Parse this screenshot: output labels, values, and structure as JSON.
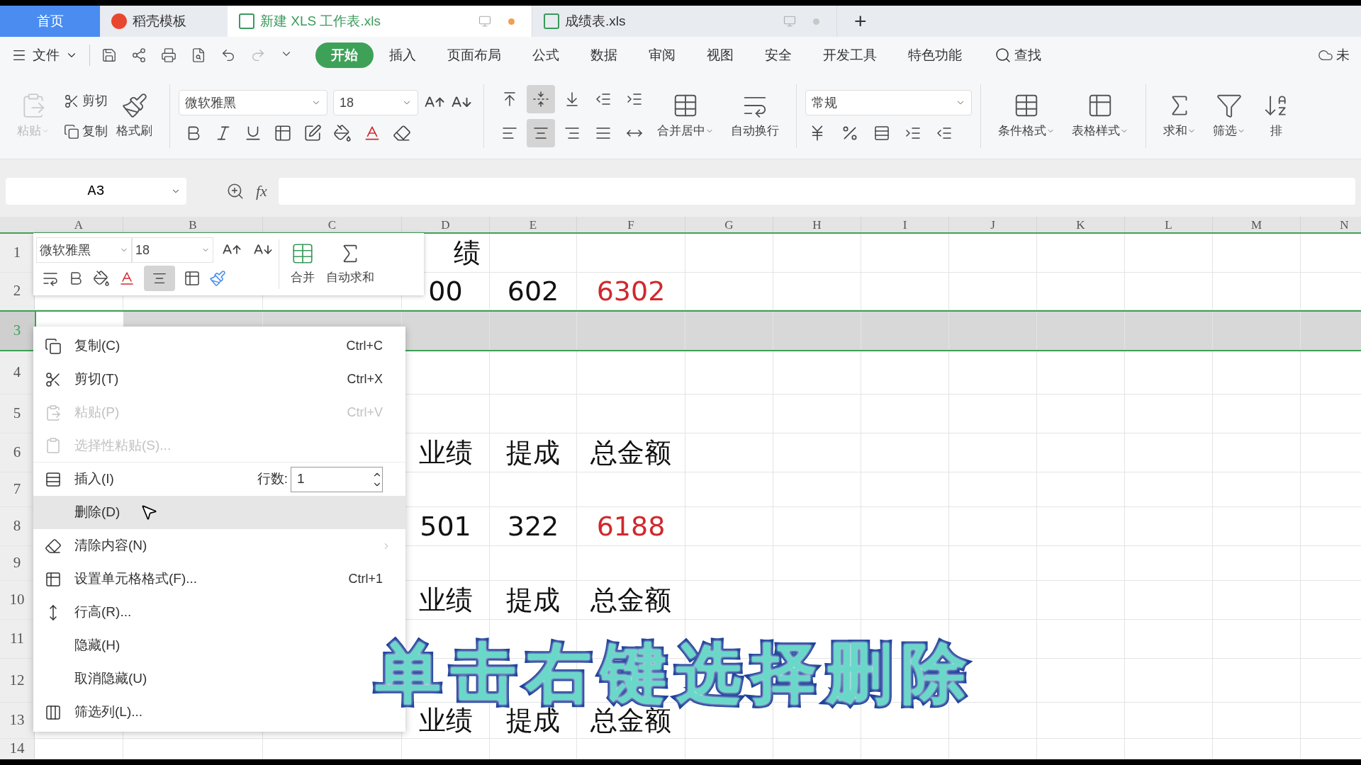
{
  "tabs": [
    {
      "label": "首页",
      "kind": "home",
      "selected": false
    },
    {
      "label": "稻壳模板",
      "kind": "docer",
      "selected": false
    },
    {
      "label": "新建 XLS 工作表.xls",
      "kind": "sheet",
      "selected": true,
      "modified": true
    },
    {
      "label": "成绩表.xls",
      "kind": "sheet",
      "selected": false,
      "modified": false
    }
  ],
  "new_tab": "+",
  "menu": {
    "file": "文件",
    "tabs": [
      {
        "label": "开始",
        "selected": true
      },
      {
        "label": "插入",
        "selected": false
      },
      {
        "label": "页面布局",
        "selected": false
      },
      {
        "label": "公式",
        "selected": false
      },
      {
        "label": "数据",
        "selected": false
      },
      {
        "label": "审阅",
        "selected": false
      },
      {
        "label": "视图",
        "selected": false
      },
      {
        "label": "安全",
        "selected": false
      },
      {
        "label": "开发工具",
        "selected": false
      },
      {
        "label": "特色功能",
        "selected": false
      }
    ],
    "search": "查找",
    "account": "未"
  },
  "ribbon": {
    "paste": {
      "label": "粘贴",
      "disabled": true
    },
    "cut": "剪切",
    "copy": "复制",
    "format_painter": "格式刷",
    "font": "微软雅黑",
    "size": "18",
    "align_top": [
      {
        "selected": false
      },
      {
        "selected": true
      },
      {
        "selected": false
      },
      {
        "selected": false
      },
      {
        "selected": false
      }
    ],
    "align_bottom": [
      {
        "selected": false
      },
      {
        "selected": true
      },
      {
        "selected": false
      },
      {
        "selected": false
      },
      {
        "selected": false
      }
    ],
    "merge": "合并居中",
    "wrap": "自动换行",
    "number_format": "常规",
    "cond_format": "条件格式",
    "table_style": "表格样式",
    "sum": "求和",
    "filter": "筛选",
    "sort": "排"
  },
  "formula_bar": {
    "name_box": "A3",
    "fx": "fx"
  },
  "columns": [
    "A",
    "B",
    "C",
    "D",
    "E",
    "F",
    "G",
    "H",
    "I",
    "J",
    "K",
    "L",
    "M",
    "N"
  ],
  "rows": [
    {
      "number": "1",
      "selected": false,
      "cells": [
        {
          "text": "绩"
        }
      ]
    },
    {
      "number": "2",
      "selected": false,
      "cells": [
        {
          "text": "00"
        },
        {
          "text": "602"
        },
        {
          "text": "6302",
          "color": "#d0282e"
        }
      ]
    },
    {
      "number": "3",
      "selected": true
    },
    {
      "number": "4",
      "selected": false
    },
    {
      "number": "5",
      "selected": false
    },
    {
      "number": "6",
      "selected": false,
      "cells": [
        {
          "text": "业绩"
        },
        {
          "text": "提成"
        },
        {
          "text": "总金额"
        }
      ]
    },
    {
      "number": "7",
      "selected": false
    },
    {
      "number": "8",
      "selected": false,
      "cells": [
        {
          "text": "501"
        },
        {
          "text": "322"
        },
        {
          "text": "6188",
          "color": "#d0282e"
        }
      ]
    },
    {
      "number": "9",
      "selected": false
    },
    {
      "number": "10",
      "selected": false,
      "cells": [
        {
          "text": "业绩"
        },
        {
          "text": "提成"
        },
        {
          "text": "总金额"
        }
      ]
    },
    {
      "number": "11",
      "selected": false
    },
    {
      "number": "12",
      "selected": false
    },
    {
      "number": "13",
      "selected": false,
      "cells": [
        {
          "text": "业绩"
        },
        {
          "text": "提成"
        },
        {
          "text": "总金额"
        }
      ]
    },
    {
      "number": "14",
      "selected": false
    }
  ],
  "mini_toolbar": {
    "font": "微软雅黑",
    "size": "18",
    "merge": "合并",
    "autosum": "自动求和",
    "align_selected": true
  },
  "context_menu": {
    "items": [
      {
        "label": "复制(C)",
        "shortcut": "Ctrl+C",
        "kind": "command",
        "disabled": false,
        "selected": false
      },
      {
        "label": "剪切(T)",
        "shortcut": "Ctrl+X",
        "kind": "command",
        "disabled": false,
        "selected": false
      },
      {
        "label": "粘贴(P)",
        "shortcut": "Ctrl+V",
        "kind": "command",
        "disabled": true,
        "selected": false
      },
      {
        "label": "选择性粘贴(S)...",
        "kind": "command",
        "disabled": true,
        "selected": false
      },
      {
        "label": "插入(I)",
        "kind": "insert",
        "count_label": "行数:",
        "count_value": "1",
        "disabled": false,
        "selected": false
      },
      {
        "label": "删除(D)",
        "kind": "command",
        "disabled": false,
        "selected": true
      },
      {
        "label": "清除内容(N)",
        "kind": "submenu",
        "disabled": false,
        "selected": false
      },
      {
        "label": "设置单元格格式(F)...",
        "shortcut": "Ctrl+1",
        "kind": "command",
        "disabled": false,
        "selected": false
      },
      {
        "label": "行高(R)...",
        "kind": "command",
        "disabled": false,
        "selected": false
      },
      {
        "label": "隐藏(H)",
        "kind": "command",
        "disabled": false,
        "selected": false
      },
      {
        "label": "取消隐藏(U)",
        "kind": "command",
        "disabled": false,
        "selected": false
      },
      {
        "label": "筛选列(L)...",
        "kind": "command",
        "disabled": false,
        "selected": false
      }
    ]
  },
  "caption": "单击右键选择删除"
}
